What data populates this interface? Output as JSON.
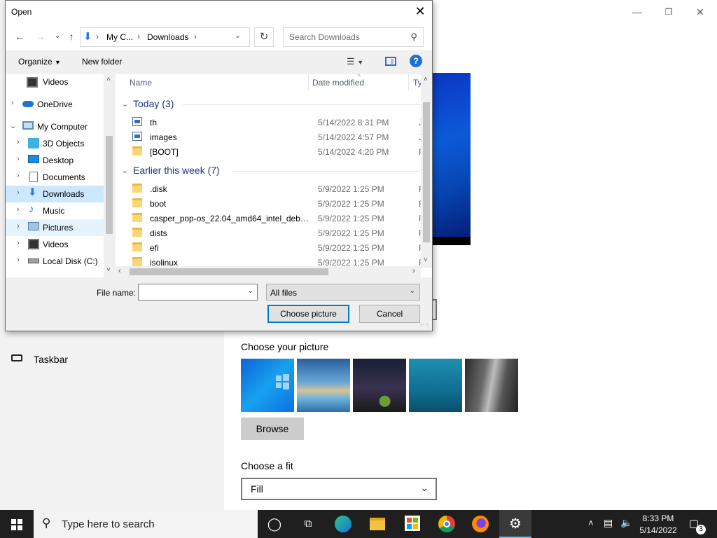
{
  "settings": {
    "nav_taskbar": "Taskbar",
    "choose_picture_label": "Choose your picture",
    "browse_label": "Browse",
    "choose_fit_label": "Choose a fit",
    "fit_value": "Fill"
  },
  "dialog": {
    "title": "Open",
    "breadcrumbs": [
      "My C...",
      "Downloads"
    ],
    "search_placeholder": "Search Downloads",
    "toolbar": {
      "organize": "Organize",
      "new_folder": "New folder"
    },
    "nav_items": [
      {
        "label": "Videos",
        "icon": "video-icon"
      },
      {
        "label": "OneDrive",
        "icon": "cloud-icon"
      },
      {
        "label": "My Computer",
        "icon": "computer-icon"
      },
      {
        "label": "3D Objects",
        "icon": "cube-icon"
      },
      {
        "label": "Desktop",
        "icon": "desktop-icon"
      },
      {
        "label": "Documents",
        "icon": "document-icon"
      },
      {
        "label": "Downloads",
        "icon": "download-icon"
      },
      {
        "label": "Music",
        "icon": "music-icon"
      },
      {
        "label": "Pictures",
        "icon": "picture-icon"
      },
      {
        "label": "Videos",
        "icon": "video-icon"
      },
      {
        "label": "Local Disk (C:)",
        "icon": "drive-icon"
      }
    ],
    "columns": {
      "name": "Name",
      "date": "Date modified",
      "type": "Ty"
    },
    "groups": [
      {
        "title": "Today (3)",
        "files": [
          {
            "name": "th",
            "date": "5/14/2022 8:31 PM",
            "type": "JF",
            "icon": "image-file-icon"
          },
          {
            "name": "images",
            "date": "5/14/2022 4:57 PM",
            "type": "JF",
            "icon": "image-file-icon"
          },
          {
            "name": "[BOOT]",
            "date": "5/14/2022 4:20 PM",
            "type": "Fi",
            "icon": "folder-icon"
          }
        ]
      },
      {
        "title": "Earlier this week (7)",
        "files": [
          {
            "name": ".disk",
            "date": "5/9/2022 1:25 PM",
            "type": "Fi",
            "icon": "folder-icon"
          },
          {
            "name": "boot",
            "date": "5/9/2022 1:25 PM",
            "type": "Fi",
            "icon": "folder-icon"
          },
          {
            "name": "casper_pop-os_22.04_amd64_intel_debug...",
            "date": "5/9/2022 1:25 PM",
            "type": "Fi",
            "icon": "folder-icon"
          },
          {
            "name": "dists",
            "date": "5/9/2022 1:25 PM",
            "type": "Fi",
            "icon": "folder-icon"
          },
          {
            "name": "efi",
            "date": "5/9/2022 1:25 PM",
            "type": "Fi",
            "icon": "folder-icon"
          },
          {
            "name": "isolinux",
            "date": "5/9/2022 1:25 PM",
            "type": "Fi",
            "icon": "folder-icon"
          }
        ]
      }
    ],
    "file_name_label": "File name:",
    "file_name_value": "",
    "file_type": "All files",
    "choose_button": "Choose picture",
    "cancel_button": "Cancel"
  },
  "taskbar": {
    "search_placeholder": "Type here to search",
    "pinned_icons": [
      "cortana-icon",
      "task-view-icon",
      "edge-icon",
      "file-explorer-icon",
      "store-icon",
      "chrome-icon",
      "firefox-icon",
      "settings-icon"
    ],
    "time": "8:33 PM",
    "date": "5/14/2022",
    "notification_count": "3"
  },
  "colors": {
    "accent": "#0078d7",
    "selection": "#cce8ff",
    "taskbar": "#1f1f1f"
  }
}
